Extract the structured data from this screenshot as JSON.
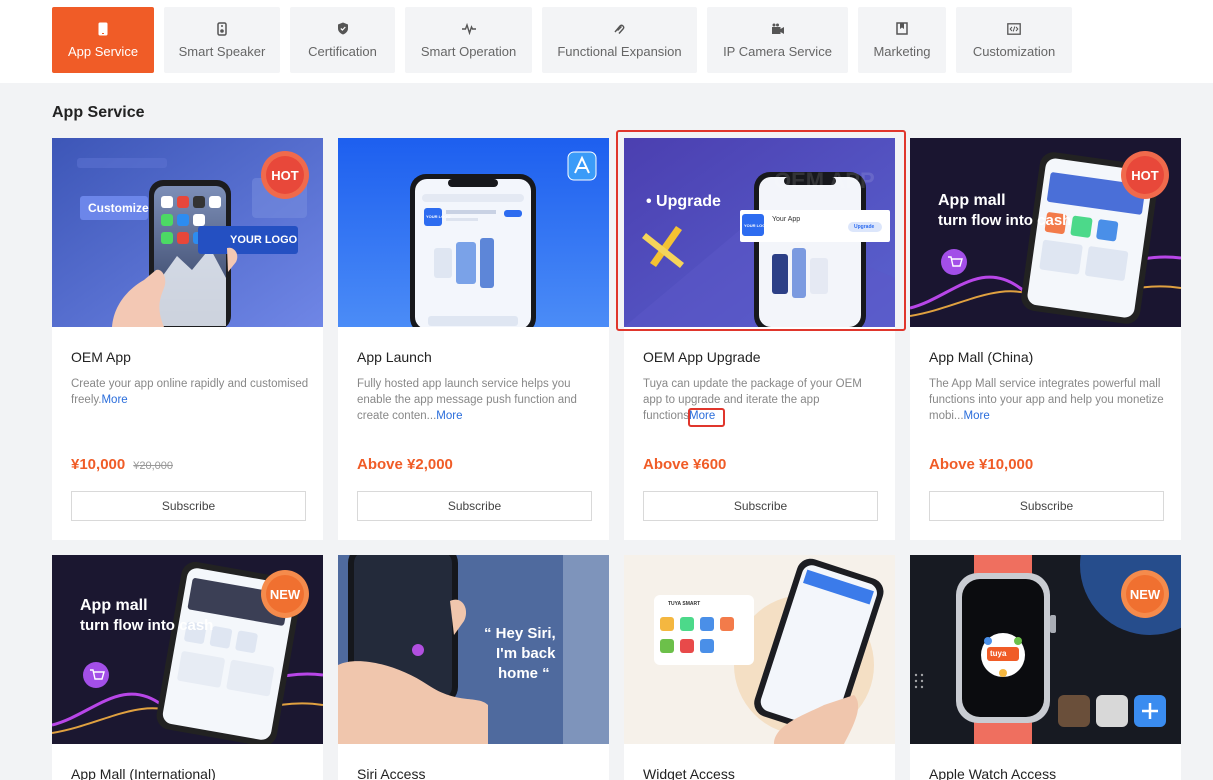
{
  "tabs": [
    {
      "label": "App Service",
      "icon": "phone-icon",
      "active": true
    },
    {
      "label": "Smart Speaker",
      "icon": "speaker-icon"
    },
    {
      "label": "Certification",
      "icon": "shield-icon"
    },
    {
      "label": "Smart Operation",
      "icon": "pulse-icon"
    },
    {
      "label": "Functional Expansion",
      "icon": "link-icon"
    },
    {
      "label": "IP Camera Service",
      "icon": "camera-icon"
    },
    {
      "label": "Marketing",
      "icon": "bookmark-icon"
    },
    {
      "label": "Customization",
      "icon": "code-icon"
    }
  ],
  "section": {
    "title": "App Service"
  },
  "cards": [
    {
      "title": "OEM App",
      "desc": "Create your app online rapidly and customised freely.",
      "more": "More",
      "price": "¥10,000",
      "old_price": "¥20,000",
      "subscribe": "Subscribe",
      "badge": "HOT",
      "image_text": {
        "customize": "Customize",
        "logo": "YOUR LOGO"
      }
    },
    {
      "title": "App Launch",
      "desc": "Fully hosted app launch service helps you enable the app message push function and create conten...",
      "more": "More",
      "price": "Above ¥2,000",
      "subscribe": "Subscribe",
      "image_text": {
        "logo": "YOUR LOGO"
      }
    },
    {
      "title": "OEM App Upgrade",
      "desc": "Tuya can update the package of your OEM app to upgrade and iterate the app functions",
      "more": "More",
      "price": "Above ¥600",
      "subscribe": "Subscribe",
      "image_text": {
        "headline": "• Upgrade",
        "watermark": "OEM APP",
        "app_name": "Your App",
        "logo": "YOUR LOGO",
        "button": "Upgrade"
      }
    },
    {
      "title": "App Mall (China)",
      "desc": "The App Mall service integrates powerful mall functions into your app and help you monetize mobi...",
      "more": "More",
      "price": "Above ¥10,000",
      "subscribe": "Subscribe",
      "badge": "HOT",
      "image_text": {
        "line1": "App mall",
        "line2": "turn flow into cash"
      }
    },
    {
      "title": "App Mall (International)",
      "badge": "NEW",
      "image_text": {
        "line1": "App mall",
        "line2": "turn flow into cash"
      }
    },
    {
      "title": "Siri Access",
      "image_text": {
        "line1": "“ Hey Siri,",
        "line2": "I'm back",
        "line3": "home “"
      }
    },
    {
      "title": "Widget Access",
      "image_text": {
        "brand": "TUYA SMART"
      }
    },
    {
      "title": "Apple Watch Access",
      "badge": "NEW",
      "image_text": {
        "brand": "tuya"
      }
    }
  ],
  "colors": {
    "accent": "#f05c27",
    "link": "#2a6ddb",
    "highlight": "#e0362c"
  }
}
